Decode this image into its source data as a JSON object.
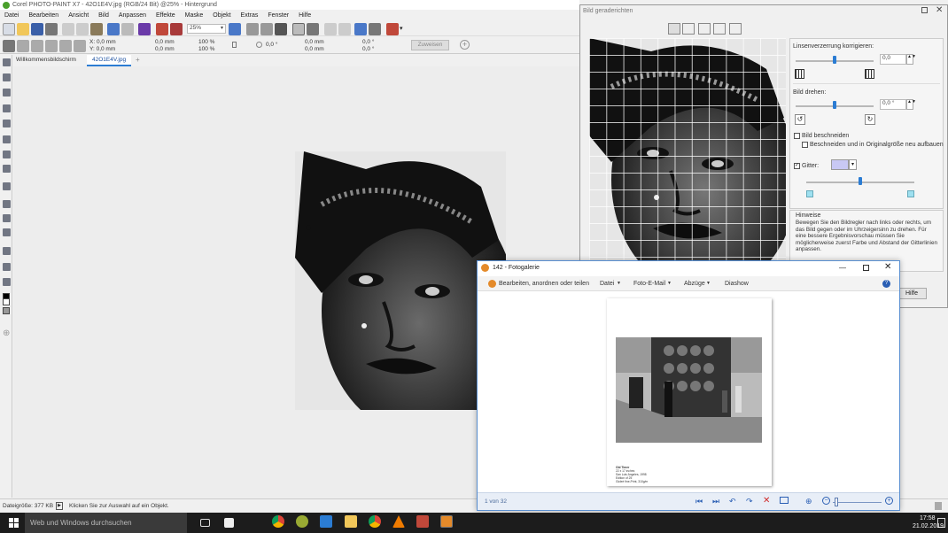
{
  "app": {
    "title": "Corel PHOTO-PAINT X7 - 42O1E4V.jpg (RGB/24 Bit) @25% - Hintergrund",
    "menu": [
      "Datei",
      "Bearbeiten",
      "Ansicht",
      "Bild",
      "Anpassen",
      "Effekte",
      "Maske",
      "Objekt",
      "Extras",
      "Fenster",
      "Hilfe"
    ],
    "zoom": "25%",
    "prop": {
      "x": "X: 0,0 mm",
      "y": "Y: 0,0 mm",
      "w": "0,0 mm",
      "h": "0,0 mm",
      "sx": "100 %",
      "sy": "100 %",
      "rot": "0,0 °",
      "px": "0,0 mm",
      "py": "0,0 mm",
      "sk1": "0,0 °",
      "sk2": "0,0 °",
      "apply": "Zuweisen"
    },
    "tabs": [
      "Willkommensbildschirm",
      "42O1E4V.jpg"
    ],
    "status": {
      "size": "Dateigröße: 377 KB",
      "hint": "Klicken Sie zur Auswahl auf ein Objekt."
    }
  },
  "straighten": {
    "title": "Bild geraderichten",
    "lens_label": "Linsenverzerrung korrigieren:",
    "lens_value": "0,0",
    "rotate_label": "Bild drehen:",
    "rotate_value": "0,0 °",
    "crop_label": "Bild beschneiden",
    "crop_sub": "Beschneiden und in Originalgröße neu aufbauen",
    "grid_label": "Gitter:",
    "notes_title": "Hinweise",
    "notes_text": "Bewegen Sie den Bildregler nach links oder rechts, um das Bild gegen oder im Uhrzeigersinn zu drehen. Für eine bessere Ergebnisvorschau müssen Sie möglicherweise zuerst Farbe und Abstand der Gitterlinien anpassen.",
    "help": "Hilfe",
    "lens_slider": 0.5,
    "rotate_slider": 0.5,
    "grid_slider": 0.5,
    "grid_color": "#c8c8f4"
  },
  "gallery": {
    "title": "142 - Fotogalerie",
    "toolbar": [
      "Bearbeiten, anordnen oder teilen",
      "Datei",
      "Foto-E-Mail",
      "Abzüge",
      "Diashow"
    ],
    "page_caption": [
      "Old Timer",
      "22 x 17 inches",
      "San Luis Angeles, 1998",
      "Edition of 25",
      "Gicleé fine-Print, 310g/m"
    ],
    "counter": "1 von 32"
  },
  "taskbar": {
    "search": "Web und Windows durchsuchen",
    "time": "17:58",
    "date": "21.02.2019"
  },
  "colors": {
    "accent": "#2b7cd3",
    "taskbar": "#1c1c1c"
  }
}
